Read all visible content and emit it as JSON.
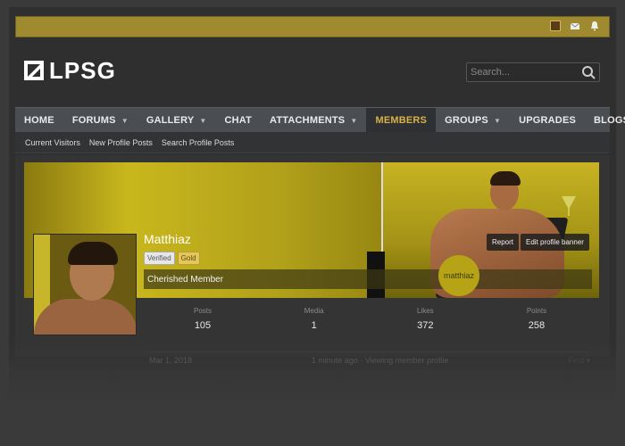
{
  "topbar": {
    "icons": [
      "user-avatar-icon",
      "mail-icon",
      "bell-icon"
    ]
  },
  "logo": {
    "text": "LPSG",
    "icon": "lpsg-logo-icon"
  },
  "search": {
    "placeholder": "Search...",
    "icon": "search-icon"
  },
  "nav": {
    "items": [
      {
        "label": "HOME",
        "dropdown": false
      },
      {
        "label": "FORUMS",
        "dropdown": true
      },
      {
        "label": "GALLERY",
        "dropdown": true
      },
      {
        "label": "CHAT",
        "dropdown": false
      },
      {
        "label": "ATTACHMENTS",
        "dropdown": true
      },
      {
        "label": "MEMBERS",
        "dropdown": false,
        "active": true
      },
      {
        "label": "GROUPS",
        "dropdown": true
      },
      {
        "label": "UPGRADES",
        "dropdown": false
      },
      {
        "label": "BLOGS",
        "dropdown": true
      }
    ]
  },
  "subnav": {
    "items": [
      "Current Visitors",
      "New Profile Posts",
      "Search Profile Posts"
    ]
  },
  "profile": {
    "username": "Matthiaz",
    "badges": [
      "Verified",
      "Gold"
    ],
    "user_title": "Cherished Member",
    "sticker_text": "matthiaz",
    "actions": {
      "report": "Report",
      "edit_banner": "Edit profile banner"
    },
    "stats": [
      {
        "label": "Posts",
        "value": "105"
      },
      {
        "label": "Media",
        "value": "1"
      },
      {
        "label": "Likes",
        "value": "372"
      },
      {
        "label": "Points",
        "value": "258"
      }
    ],
    "last_row": {
      "joined": "Mar 1, 2018",
      "activity": "1 minute ago · Viewing member profile",
      "find": "Find ▾"
    }
  },
  "colors": {
    "accent": "#d8b246",
    "topbar": "#a08a2f",
    "nav_bg": "#4a4d52"
  }
}
